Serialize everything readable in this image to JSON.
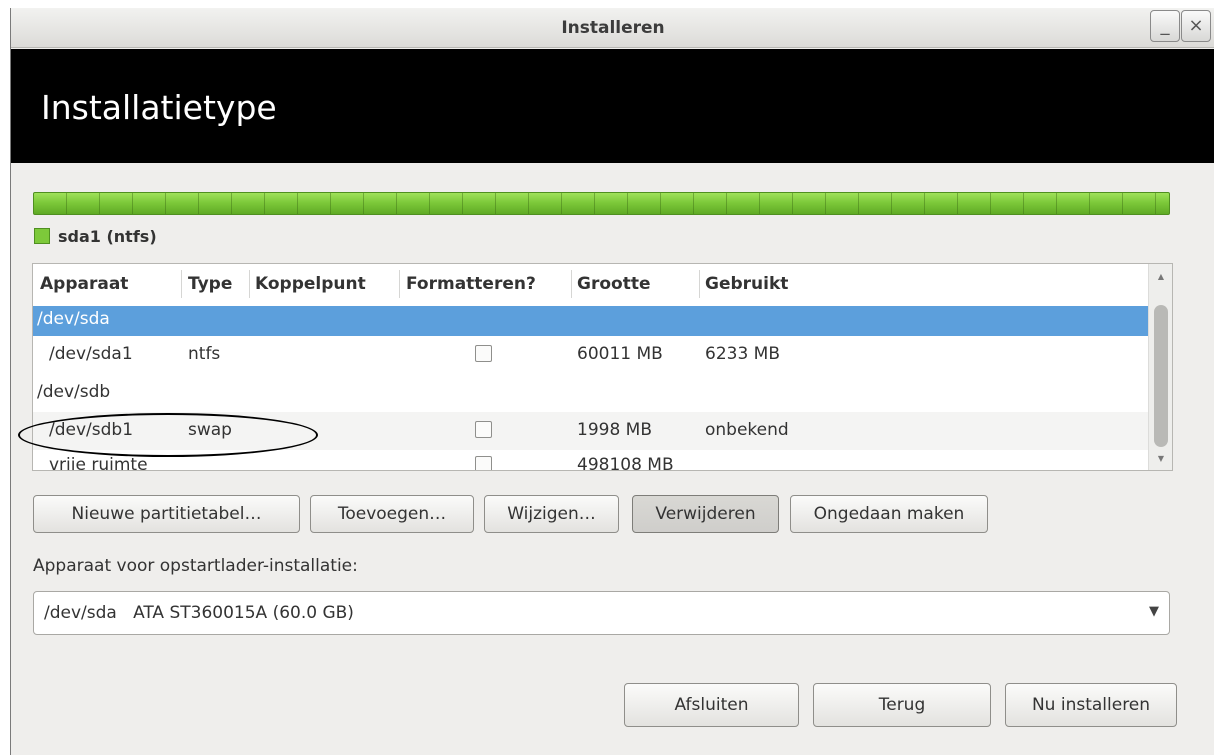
{
  "window": {
    "title": "Installeren",
    "minimize_label": "_",
    "close_label": "×"
  },
  "header": {
    "title": "Installatietype"
  },
  "partition_bar": {
    "color": "#7dc93a",
    "legend": "sda1 (ntfs)"
  },
  "table": {
    "columns": [
      "Apparaat",
      "Type",
      "Koppelpunt",
      "Formatteren?",
      "Grootte",
      "Gebruikt"
    ],
    "rows": [
      {
        "device": "/dev/sda",
        "type": "",
        "mount": "",
        "format": null,
        "size": "",
        "used": "",
        "selected": true
      },
      {
        "device": "/dev/sda1",
        "type": "ntfs",
        "mount": "",
        "format": false,
        "size": "60011 MB",
        "used": "6233 MB"
      },
      {
        "device": "/dev/sdb",
        "type": "",
        "mount": "",
        "format": null,
        "size": "",
        "used": ""
      },
      {
        "device": "/dev/sdb1",
        "type": "swap",
        "mount": "",
        "format": false,
        "size": "1998 MB",
        "used": "onbekend"
      },
      {
        "device": "vrije ruimte",
        "type": "",
        "mount": "",
        "format": false,
        "size": "498108 MB",
        "used": ""
      }
    ]
  },
  "buttons": {
    "new_table": "Nieuwe partitietabel…",
    "add": "Toevoegen…",
    "change": "Wijzigen…",
    "delete": "Verwijderen",
    "undo": "Ongedaan maken"
  },
  "bootloader": {
    "label": "Apparaat voor opstartlader-installatie:",
    "selected_device": "/dev/sda",
    "selected_desc": "ATA ST360015A (60.0 GB)"
  },
  "footer": {
    "quit": "Afsluiten",
    "back": "Terug",
    "install": "Nu installeren"
  },
  "colors": {
    "selection": "#5c9fdc",
    "header_bg": "#000000",
    "partition": "#7dc93a"
  }
}
